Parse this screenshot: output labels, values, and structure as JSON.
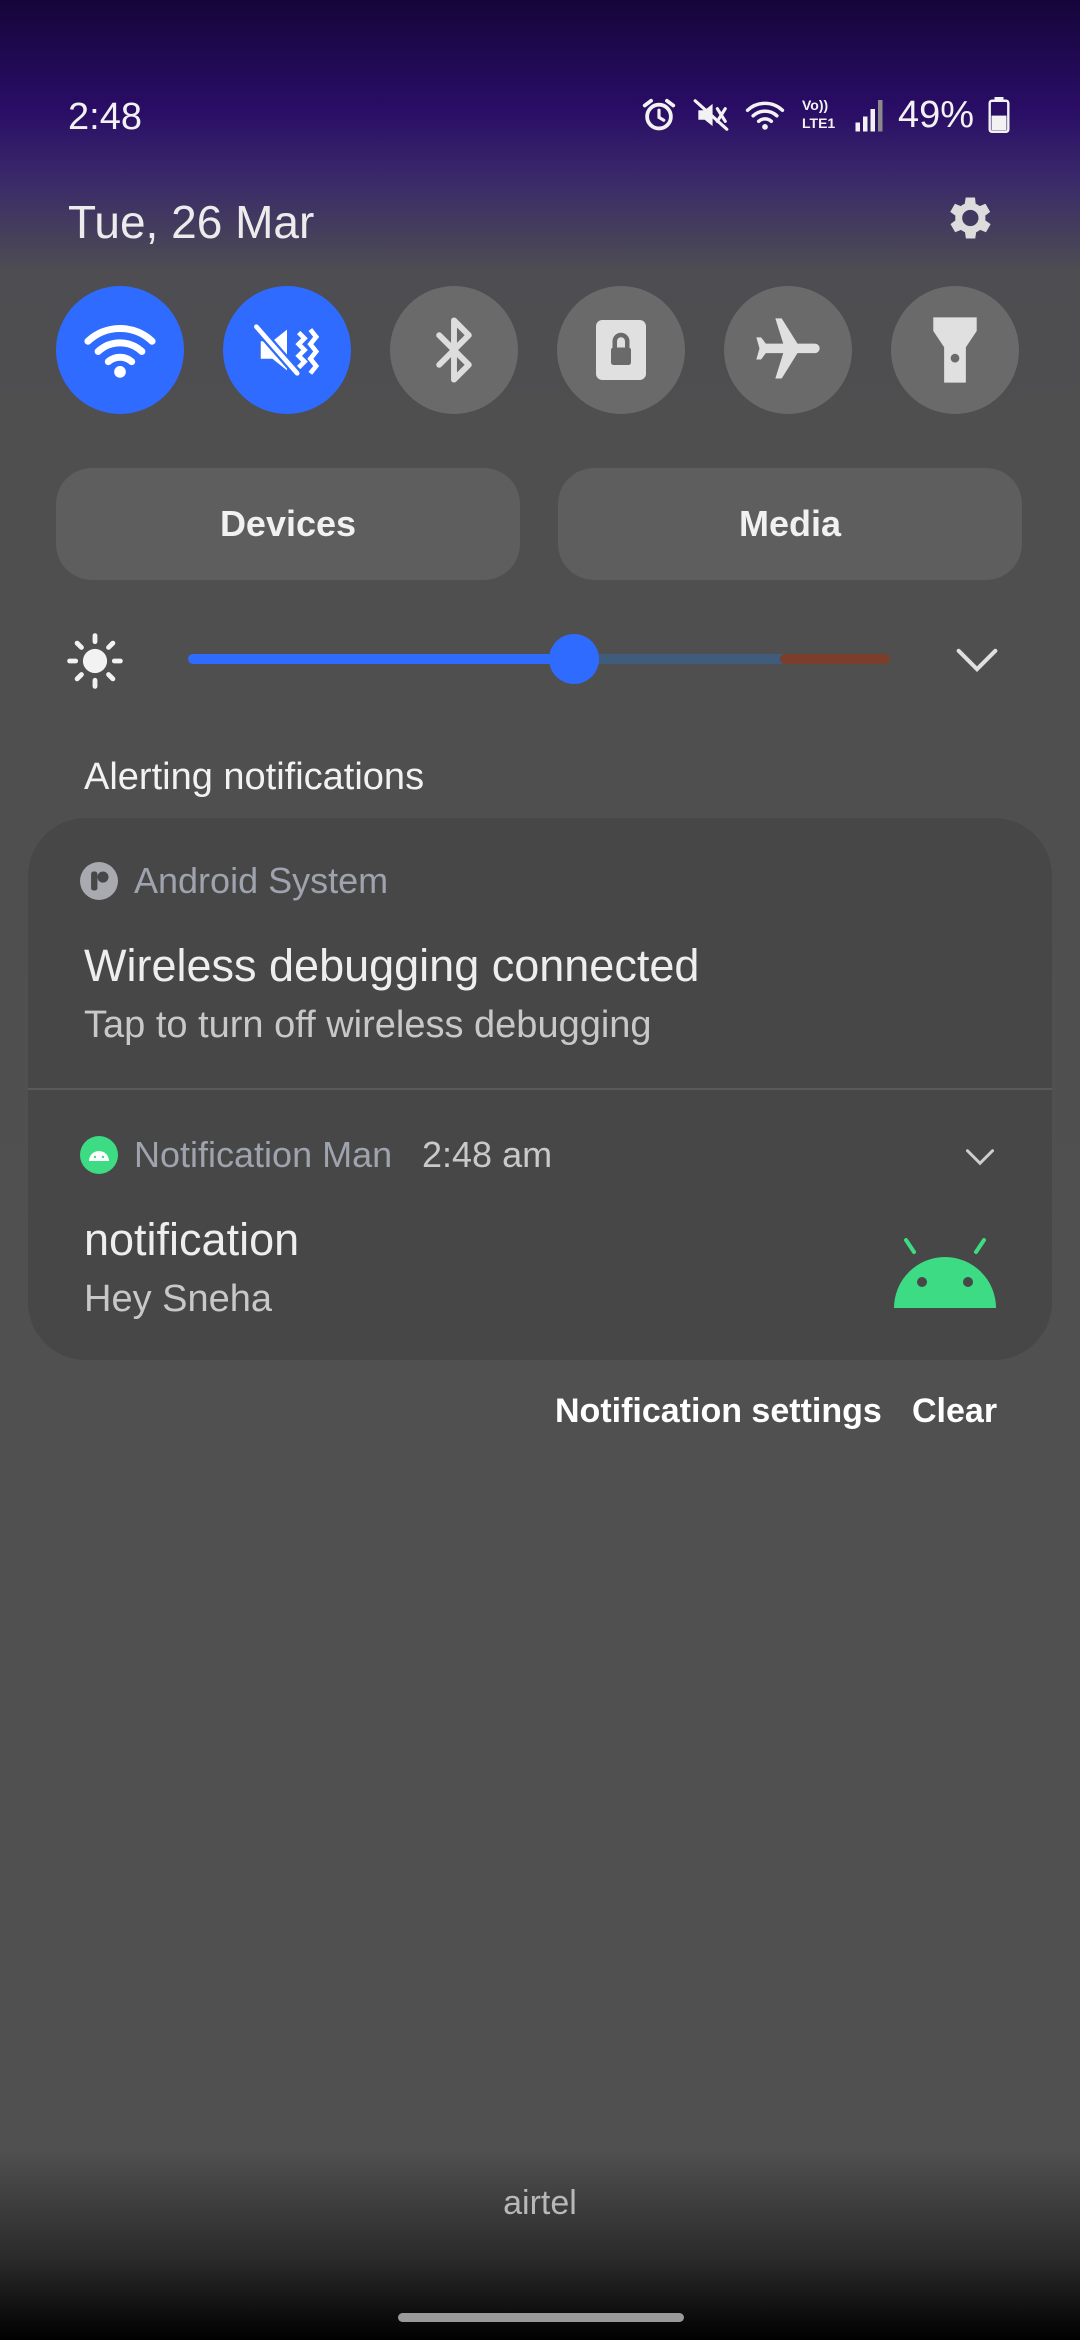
{
  "status_bar": {
    "time": "2:48",
    "battery_percent": "49%",
    "battery_level": 0.49,
    "icons": [
      "alarm-icon",
      "mute-icon",
      "wifi-icon",
      "volte-lte-icon",
      "signal-icon",
      "battery-icon"
    ],
    "volte_label_top": "Vo))",
    "volte_label_bottom": "LTE1"
  },
  "header": {
    "date": "Tue, 26 Mar",
    "settings_icon": "gear-icon"
  },
  "quick_toggles": [
    {
      "name": "wifi",
      "icon": "wifi-icon",
      "active": true
    },
    {
      "name": "sound",
      "icon": "mute-vibrate-icon",
      "active": true
    },
    {
      "name": "bluetooth",
      "icon": "bluetooth-icon",
      "active": false
    },
    {
      "name": "rotation-lock",
      "icon": "lock-icon",
      "active": false
    },
    {
      "name": "airplane-mode",
      "icon": "airplane-icon",
      "active": false
    },
    {
      "name": "flashlight",
      "icon": "flashlight-icon",
      "active": false
    }
  ],
  "panel_buttons": {
    "devices_label": "Devices",
    "media_label": "Media"
  },
  "brightness": {
    "level": 0.55,
    "icon": "sun-icon"
  },
  "notifications": {
    "section_title": "Alerting notifications",
    "items": [
      {
        "app": "Android System",
        "title": "Wireless debugging connected",
        "body": "Tap to turn off wireless debugging"
      },
      {
        "app": "Notification Man",
        "time": "2:48 am",
        "title": "notification",
        "body": "Hey Sneha"
      }
    ],
    "settings_label": "Notification settings",
    "clear_label": "Clear"
  },
  "carrier": "airtel",
  "colors": {
    "accent": "#2f6bff",
    "toggle_off": "#6a6a6a",
    "card": "#474747",
    "android_green": "#3ddc84"
  }
}
